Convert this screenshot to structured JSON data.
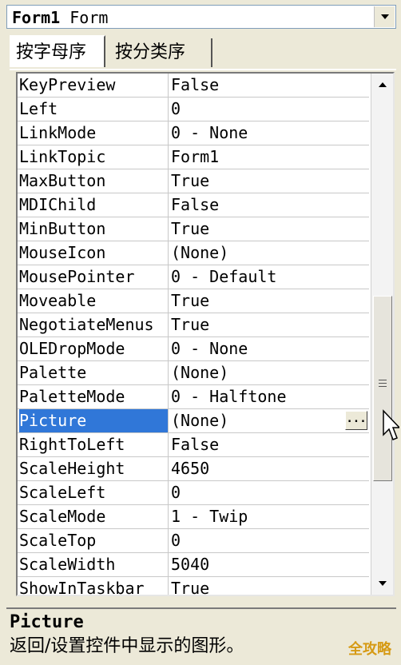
{
  "object_selector": {
    "name": "Form1",
    "type": "Form"
  },
  "tabs": [
    {
      "label": "按字母序",
      "active": true
    },
    {
      "label": "按分类序",
      "active": false
    }
  ],
  "properties": [
    {
      "name": "KeyPreview",
      "value": "False"
    },
    {
      "name": "Left",
      "value": "0"
    },
    {
      "name": "LinkMode",
      "value": "0 - None"
    },
    {
      "name": "LinkTopic",
      "value": "Form1"
    },
    {
      "name": "MaxButton",
      "value": "True"
    },
    {
      "name": "MDIChild",
      "value": "False"
    },
    {
      "name": "MinButton",
      "value": "True"
    },
    {
      "name": "MouseIcon",
      "value": "(None)"
    },
    {
      "name": "MousePointer",
      "value": "0 - Default"
    },
    {
      "name": "Moveable",
      "value": "True"
    },
    {
      "name": "NegotiateMenus",
      "value": "True"
    },
    {
      "name": "OLEDropMode",
      "value": "0 - None"
    },
    {
      "name": "Palette",
      "value": "(None)"
    },
    {
      "name": "PaletteMode",
      "value": "0 - Halftone"
    },
    {
      "name": "Picture",
      "value": "(None)",
      "selected": true,
      "button": "..."
    },
    {
      "name": "RightToLeft",
      "value": "False"
    },
    {
      "name": "ScaleHeight",
      "value": "4650"
    },
    {
      "name": "ScaleLeft",
      "value": "0"
    },
    {
      "name": "ScaleMode",
      "value": "1 - Twip"
    },
    {
      "name": "ScaleTop",
      "value": "0"
    },
    {
      "name": "ScaleWidth",
      "value": "5040"
    },
    {
      "name": "ShowInTaskbar",
      "value": "True"
    }
  ],
  "description": {
    "title": "Picture",
    "text": "返回/设置控件中显示的图形。"
  },
  "watermark": "全攻略",
  "colors": {
    "selection": "#3077d8",
    "background": "#ece9d8"
  }
}
